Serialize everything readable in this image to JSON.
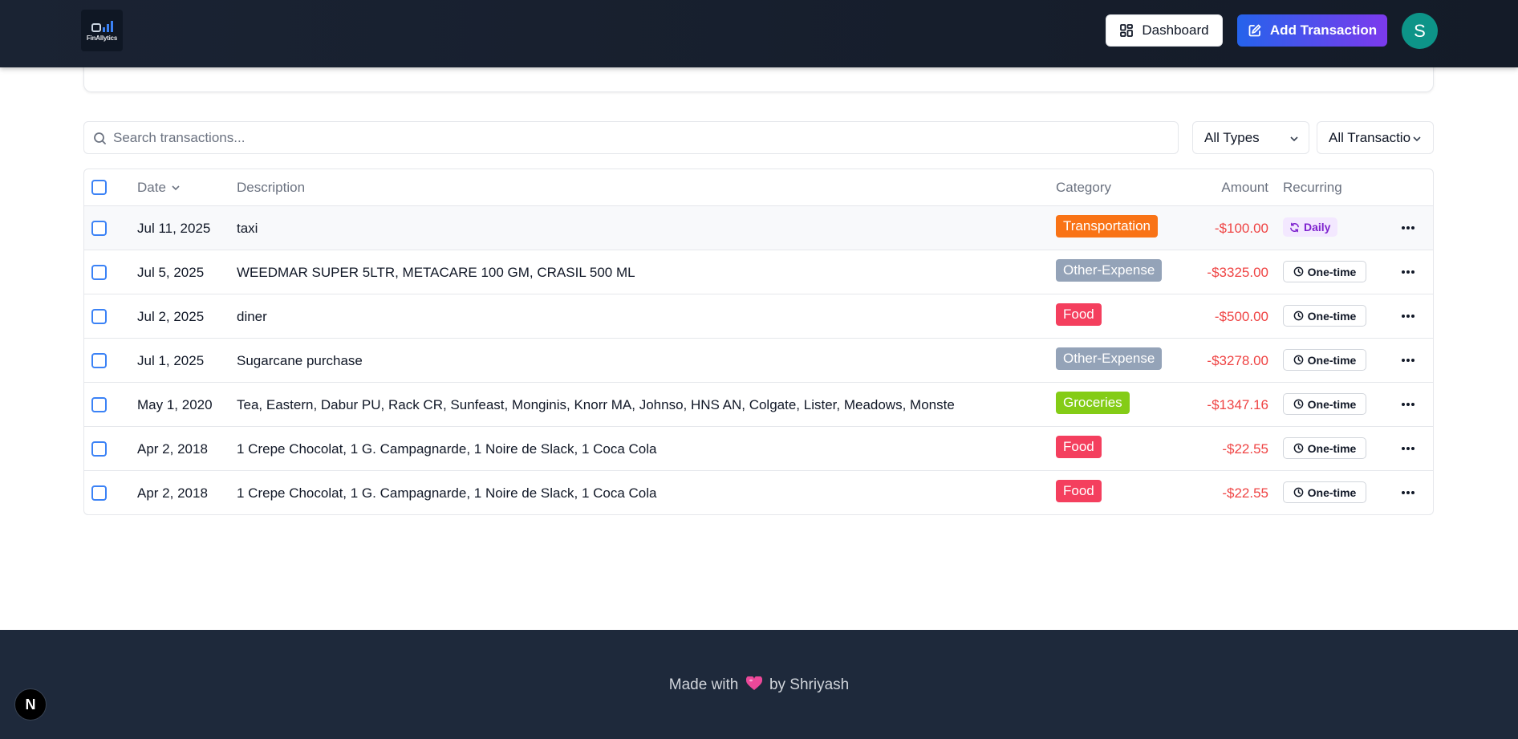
{
  "header": {
    "logo_text": "FinAllytics",
    "dashboard_label": "Dashboard",
    "add_transaction_label": "Add Transaction",
    "avatar_initial": "S"
  },
  "filters": {
    "search_placeholder": "Search transactions...",
    "type_select": "All Types",
    "transaction_select": "All Transactio"
  },
  "table": {
    "columns": {
      "date": "Date",
      "description": "Description",
      "category": "Category",
      "amount": "Amount",
      "recurring": "Recurring"
    },
    "rows": [
      {
        "date": "Jul 11, 2025",
        "description": "taxi",
        "category": "Transportation",
        "category_color": "#f97316",
        "amount": "-$100.00",
        "recurring": "Daily"
      },
      {
        "date": "Jul 5, 2025",
        "description": "WEEDMAR SUPER 5LTR, METACARE 100 GM, CRASIL 500 ML",
        "category": "Other-Expense",
        "category_color": "#94a3b8",
        "amount": "-$3325.00",
        "recurring": "One-time"
      },
      {
        "date": "Jul 2, 2025",
        "description": "diner",
        "category": "Food",
        "category_color": "#f43f5e",
        "amount": "-$500.00",
        "recurring": "One-time"
      },
      {
        "date": "Jul 1, 2025",
        "description": "Sugarcane purchase",
        "category": "Other-Expense",
        "category_color": "#94a3b8",
        "amount": "-$3278.00",
        "recurring": "One-time"
      },
      {
        "date": "May 1, 2020",
        "description": "Tea, Eastern, Dabur PU, Rack CR, Sunfeast, Monginis, Knorr MA, Johnso, HNS AN, Colgate, Lister, Meadows, Monste",
        "category": "Groceries",
        "category_color": "#84cc16",
        "amount": "-$1347.16",
        "recurring": "One-time"
      },
      {
        "date": "Apr 2, 2018",
        "description": "1 Crepe Chocolat, 1 G. Campagnarde, 1 Noire de Slack, 1 Coca Cola",
        "category": "Food",
        "category_color": "#f43f5e",
        "amount": "-$22.55",
        "recurring": "One-time"
      },
      {
        "date": "Apr 2, 2018",
        "description": "1 Crepe Chocolat, 1 G. Campagnarde, 1 Noire de Slack, 1 Coca Cola",
        "category": "Food",
        "category_color": "#f43f5e",
        "amount": "-$22.55",
        "recurring": "One-time"
      }
    ]
  },
  "footer": {
    "made_with": "Made with",
    "by": "by Shriyash"
  },
  "next_badge": "N",
  "colors": {
    "header_bg": "#1a2333",
    "amount_negative": "#ef4444",
    "accent_gradient_start": "#2563eb",
    "accent_gradient_end": "#7c3aed",
    "avatar_bg": "#0d9488",
    "footer_bg": "#1e293b"
  }
}
